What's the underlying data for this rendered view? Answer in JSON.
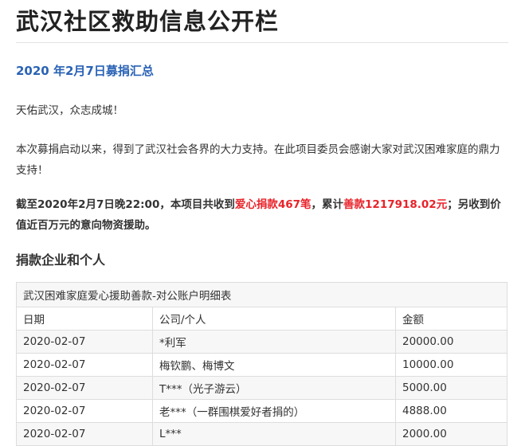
{
  "page": {
    "title": "武汉社区救助信息公开栏",
    "subheading": "2020 年2月7日募捐汇总",
    "greeting": "天佑武汉，众志成城！",
    "paragraph": "本次募捐启动以来，得到了武汉社会各界的大力支持。在此项目委员会感谢大家对武汉困难家庭的鼎力支持！",
    "summary": {
      "part1": "截至2020年2月7日晚22:00，本项目共收到",
      "highlight1": "爱心捐款467笔",
      "part2": "，累计",
      "highlight2": "善款1217918.02元",
      "part3": "；另收到价值近百万元的意向物资援助。"
    },
    "section_title": "捐款企业和个人"
  },
  "table": {
    "caption": "武汉困难家庭爱心援助善款-对公账户明细表",
    "headers": [
      "日期",
      "公司/个人",
      "金额"
    ],
    "rows": [
      [
        "2020-02-07",
        "*利军",
        "20000.00"
      ],
      [
        "2020-02-07",
        "梅钦鹏、梅博文",
        "10000.00"
      ],
      [
        "2020-02-07",
        "T***（光子游云）",
        "5000.00"
      ],
      [
        "2020-02-07",
        "老***（一群围棋爱好者捐的）",
        "4888.00"
      ],
      [
        "2020-02-07",
        "L***",
        "2000.00"
      ]
    ]
  },
  "colors": {
    "subheading": "#2a63b5",
    "highlight": "#e8232a"
  }
}
